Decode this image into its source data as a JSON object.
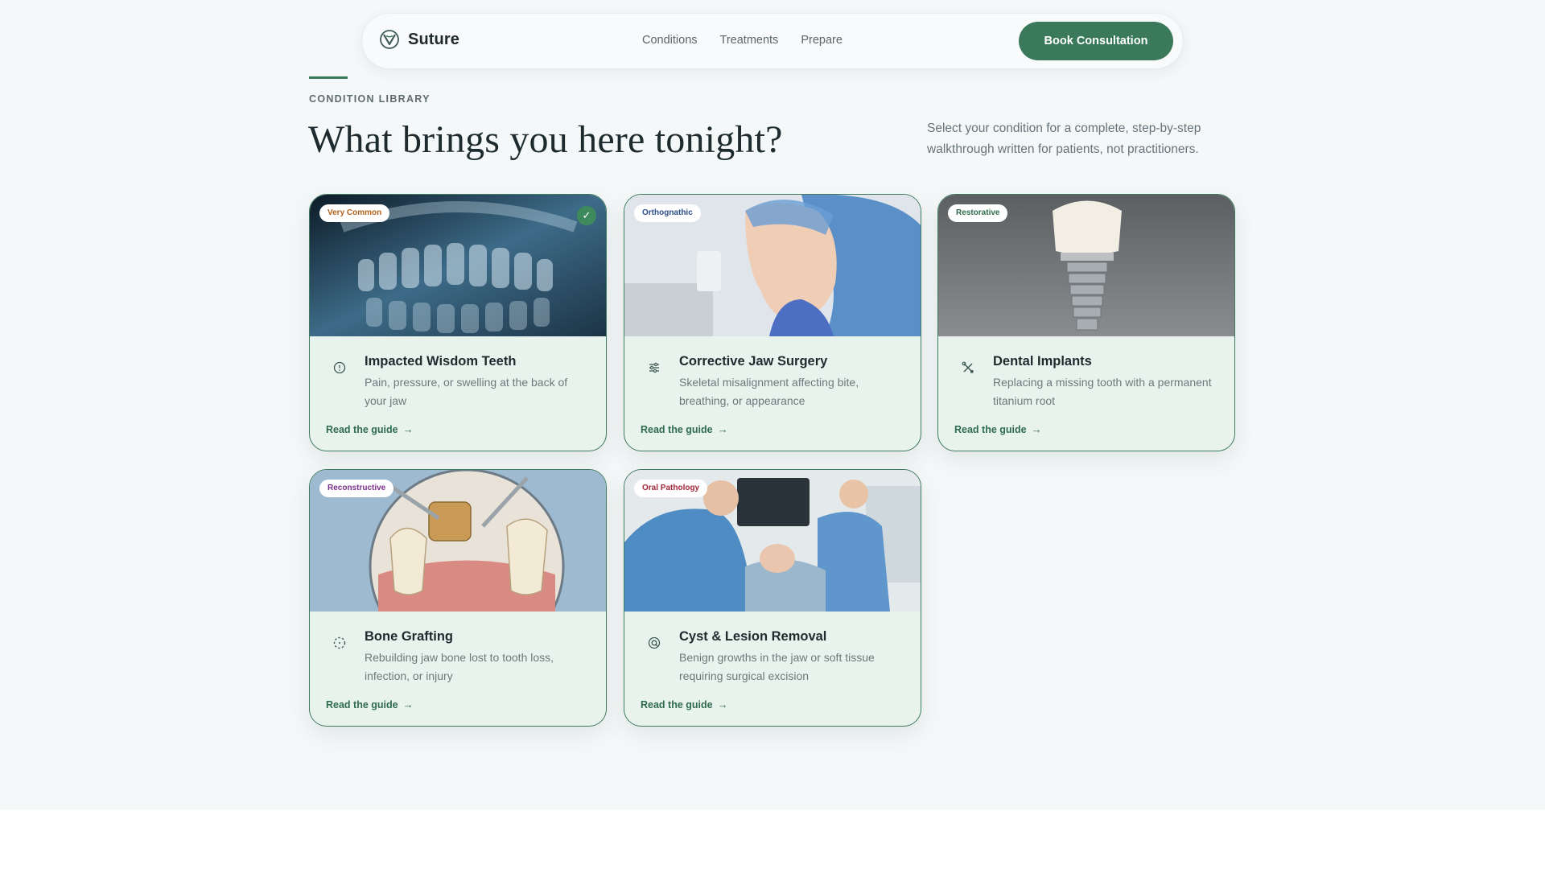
{
  "nav": {
    "brand": "Suture",
    "links": [
      "Conditions",
      "Treatments",
      "Prepare"
    ],
    "cta": "Book Consultation"
  },
  "header": {
    "eyebrow": "CONDITION LIBRARY",
    "title": "What brings you here tonight?",
    "intro": "Select your condition for a complete, step-by-step walkthrough written for patients, not practitioners."
  },
  "colors": {
    "accent": "#3a7a5a",
    "card_bg": "#e8f3ed",
    "card_border": "#3f7b5f"
  },
  "cards": [
    {
      "badge": "Very Common",
      "badge_color": "#b3631a",
      "selected": true,
      "icon": "info-circle-icon",
      "title": "Impacted Wisdom Teeth",
      "desc": "Pain, pressure, or swelling at the back of your jaw",
      "link": "Read the guide"
    },
    {
      "badge": "Orthognathic",
      "badge_color": "#2b4f8a",
      "selected": false,
      "icon": "sliders-icon",
      "title": "Corrective Jaw Surgery",
      "desc": "Skeletal misalignment affecting bite, breathing, or appearance",
      "link": "Read the guide"
    },
    {
      "badge": "Restorative",
      "badge_color": "#2f6b4d",
      "selected": false,
      "icon": "tools-icon",
      "title": "Dental Implants",
      "desc": "Replacing a missing tooth with a permanent titanium root",
      "link": "Read the guide"
    },
    {
      "badge": "Reconstructive",
      "badge_color": "#7a2f8a",
      "selected": false,
      "icon": "dashed-circle-icon",
      "title": "Bone Grafting",
      "desc": "Rebuilding jaw bone lost to tooth loss, infection, or injury",
      "link": "Read the guide"
    },
    {
      "badge": "Oral Pathology",
      "badge_color": "#a3263a",
      "selected": false,
      "icon": "target-icon",
      "title": "Cyst & Lesion Removal",
      "desc": "Benign growths in the jaw or soft tissue requiring surgical excision",
      "link": "Read the guide"
    }
  ]
}
